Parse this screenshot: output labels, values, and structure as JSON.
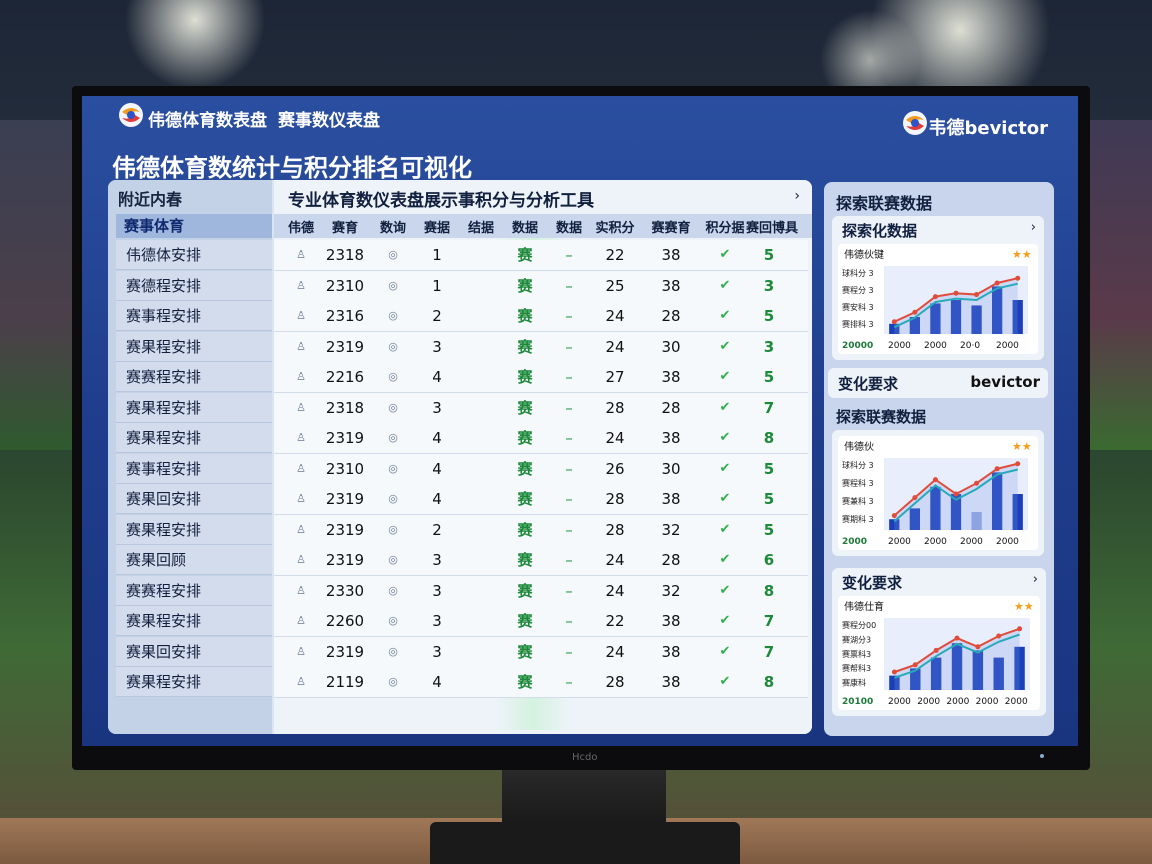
{
  "app": {
    "title": "伟德体育数表盘",
    "subtitle": "赛事数仪表盘",
    "brand": "韦德bevictor",
    "page_title": "伟德体育数统计与积分排名可视化"
  },
  "left_panel": {
    "heading": "附近内春",
    "subheading": "赛事体育",
    "rows": [
      "伟德体安排",
      "赛德程安排",
      "赛事程安排",
      "赛果程安排",
      "赛赛程安排",
      "赛果程安排",
      "赛果程安排",
      "赛事程安排",
      "赛果回安排",
      "赛果程安排",
      "赛果回顾",
      "赛赛程安排",
      "赛果程安排",
      "赛果回安排",
      "赛果程安排"
    ]
  },
  "table": {
    "title": "专业体育数仪表盘展示事积分与分析工具",
    "columns": [
      "伟德",
      "赛育",
      "数询",
      "赛据",
      "结据",
      "数据",
      "数据",
      "实积分",
      "赛赛育",
      "积分据",
      "赛回博具"
    ],
    "rows": [
      [
        "2318",
        "1",
        "赛",
        "22",
        "38",
        "5"
      ],
      [
        "2310",
        "1",
        "赛",
        "25",
        "38",
        "3"
      ],
      [
        "2316",
        "2",
        "赛",
        "24",
        "28",
        "5"
      ],
      [
        "2319",
        "3",
        "赛",
        "24",
        "30",
        "3"
      ],
      [
        "2216",
        "4",
        "赛",
        "27",
        "38",
        "5"
      ],
      [
        "2318",
        "3",
        "赛",
        "28",
        "28",
        "7"
      ],
      [
        "2319",
        "4",
        "赛",
        "24",
        "38",
        "8"
      ],
      [
        "2310",
        "4",
        "赛",
        "26",
        "30",
        "5"
      ],
      [
        "2319",
        "4",
        "赛",
        "28",
        "38",
        "5"
      ],
      [
        "2319",
        "2",
        "赛",
        "28",
        "32",
        "5"
      ],
      [
        "2319",
        "3",
        "赛",
        "24",
        "28",
        "6"
      ],
      [
        "2330",
        "3",
        "赛",
        "24",
        "32",
        "8"
      ],
      [
        "2260",
        "3",
        "赛",
        "22",
        "38",
        "7"
      ],
      [
        "2319",
        "3",
        "赛",
        "24",
        "38",
        "7"
      ],
      [
        "2119",
        "4",
        "赛",
        "28",
        "38",
        "8"
      ]
    ]
  },
  "side_panel": {
    "title": "探索联赛数据",
    "card1": {
      "title": "探索化数据",
      "chart_label": "伟德伙键",
      "y_labels": [
        "球科分 3",
        "赛程分 3",
        "赛安科 3",
        "赛排科 3"
      ],
      "x_labels": [
        "2000",
        "2000",
        "20·0",
        "2000"
      ],
      "corner": "20000",
      "bars": [
        0.15,
        0.25,
        0.45,
        0.5,
        0.42,
        0.7,
        0.5
      ],
      "line": [
        0.18,
        0.32,
        0.55,
        0.6,
        0.58,
        0.75,
        0.82
      ]
    },
    "mid_bar": {
      "label": "变化要求",
      "brand": "bevictor"
    },
    "card2": {
      "title": "探索联赛数据",
      "chart_label": "伟德伙",
      "y_labels": [
        "球科分 3",
        "赛程科 3",
        "赛兼科 3",
        "赛期科 3"
      ],
      "x_labels": [
        "2000",
        "2000",
        "2000",
        "2000"
      ],
      "corner": "2000",
      "bars": [
        0.15,
        0.3,
        0.6,
        0.5,
        0.25,
        0.8,
        0.5
      ],
      "line": [
        0.2,
        0.45,
        0.7,
        0.5,
        0.65,
        0.85,
        0.92
      ]
    },
    "card3": {
      "title": "变化要求",
      "chart_label": "伟德仕育",
      "y_labels": [
        "赛程分00",
        "赛湖分3",
        "赛票科3",
        "赛帮科3",
        "赛康科"
      ],
      "x_labels": [
        "2000",
        "2000",
        "2000",
        "2000",
        "2000"
      ],
      "corner": "20100",
      "bars": [
        0.2,
        0.3,
        0.45,
        0.65,
        0.55,
        0.45,
        0.6
      ],
      "line": [
        0.25,
        0.35,
        0.55,
        0.72,
        0.6,
        0.75,
        0.85
      ]
    }
  },
  "colors": {
    "screen_bg": "#1f3d8c",
    "bar": "#1a3fb8",
    "line_red": "#e04b3a",
    "line_teal": "#28a9b8",
    "check_green": "#2dae49",
    "star": "#f2a019"
  },
  "monitor_brand": "Hcdo"
}
